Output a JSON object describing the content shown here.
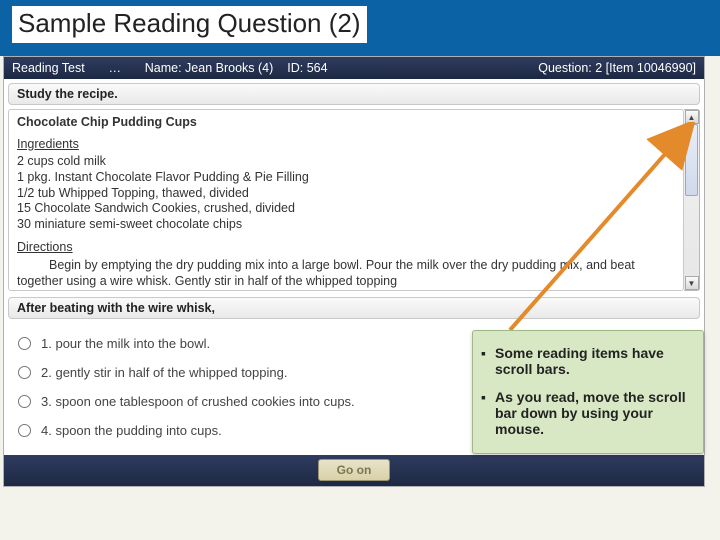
{
  "slide": {
    "title": "Sample Reading Question (2)"
  },
  "topbar": {
    "test_label": "Reading Test",
    "dots": "…",
    "name_label": "Name: Jean Brooks (4)",
    "id_label": "ID: 564",
    "question_label": "Question: 2 [Item 10046990]"
  },
  "study_prompt": "Study the recipe.",
  "passage": {
    "title": "Chocolate Chip Pudding Cups",
    "ingredients_heading": "Ingredients",
    "ingredients": [
      "2 cups cold milk",
      "1 pkg. Instant Chocolate Flavor Pudding & Pie Filling",
      "1/2 tub Whipped Topping, thawed, divided",
      "15 Chocolate Sandwich Cookies, crushed, divided",
      "30 miniature semi-sweet chocolate chips"
    ],
    "directions_heading": "Directions",
    "directions_text": "Begin by emptying the dry pudding mix into a large bowl. Pour the milk over the dry pudding mix, and beat together using a wire whisk. Gently stir in half of the whipped topping"
  },
  "question_stem": "After beating with the wire whisk,",
  "answers": [
    {
      "num": "1.",
      "text": "pour the milk into the bowl."
    },
    {
      "num": "2.",
      "text": "gently stir in half of the whipped topping."
    },
    {
      "num": "3.",
      "text": "spoon one tablespoon of crushed cookies into cups."
    },
    {
      "num": "4.",
      "text": "spoon the pudding into cups."
    }
  ],
  "go_on": "Go on",
  "callout": {
    "b1": "Some reading items have scroll bars.",
    "b2": "As you read, move the scroll bar down by using your mouse."
  },
  "icons": {
    "up": "▲",
    "down": "▼",
    "bullet": "▪"
  }
}
